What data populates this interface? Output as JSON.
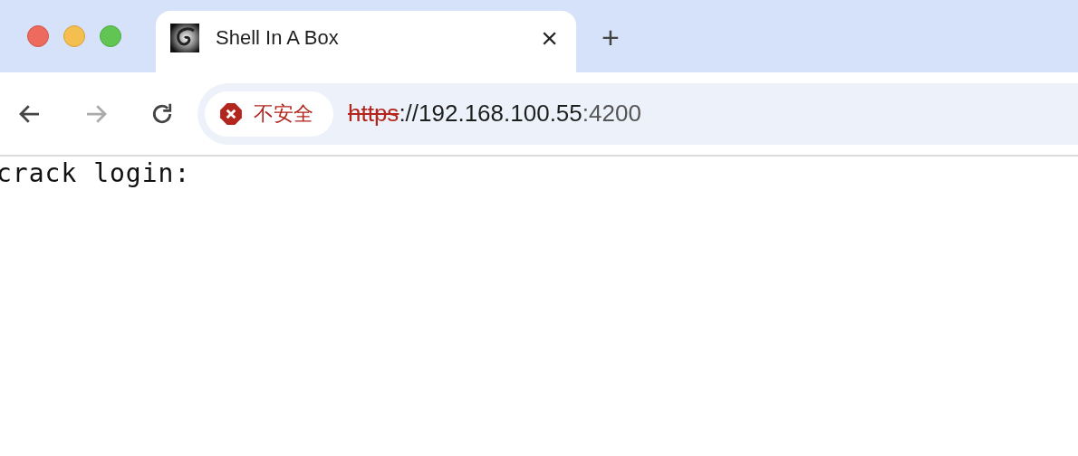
{
  "tabs": [
    {
      "title": "Shell In A Box",
      "selected": true,
      "close": "×"
    }
  ],
  "new_tab": "+",
  "address_bar": {
    "security_label": "不安全",
    "scheme": "https",
    "host": "://192.168.100.55",
    "port": ":4200"
  },
  "terminal": {
    "lines": [
      "crack login:"
    ]
  }
}
